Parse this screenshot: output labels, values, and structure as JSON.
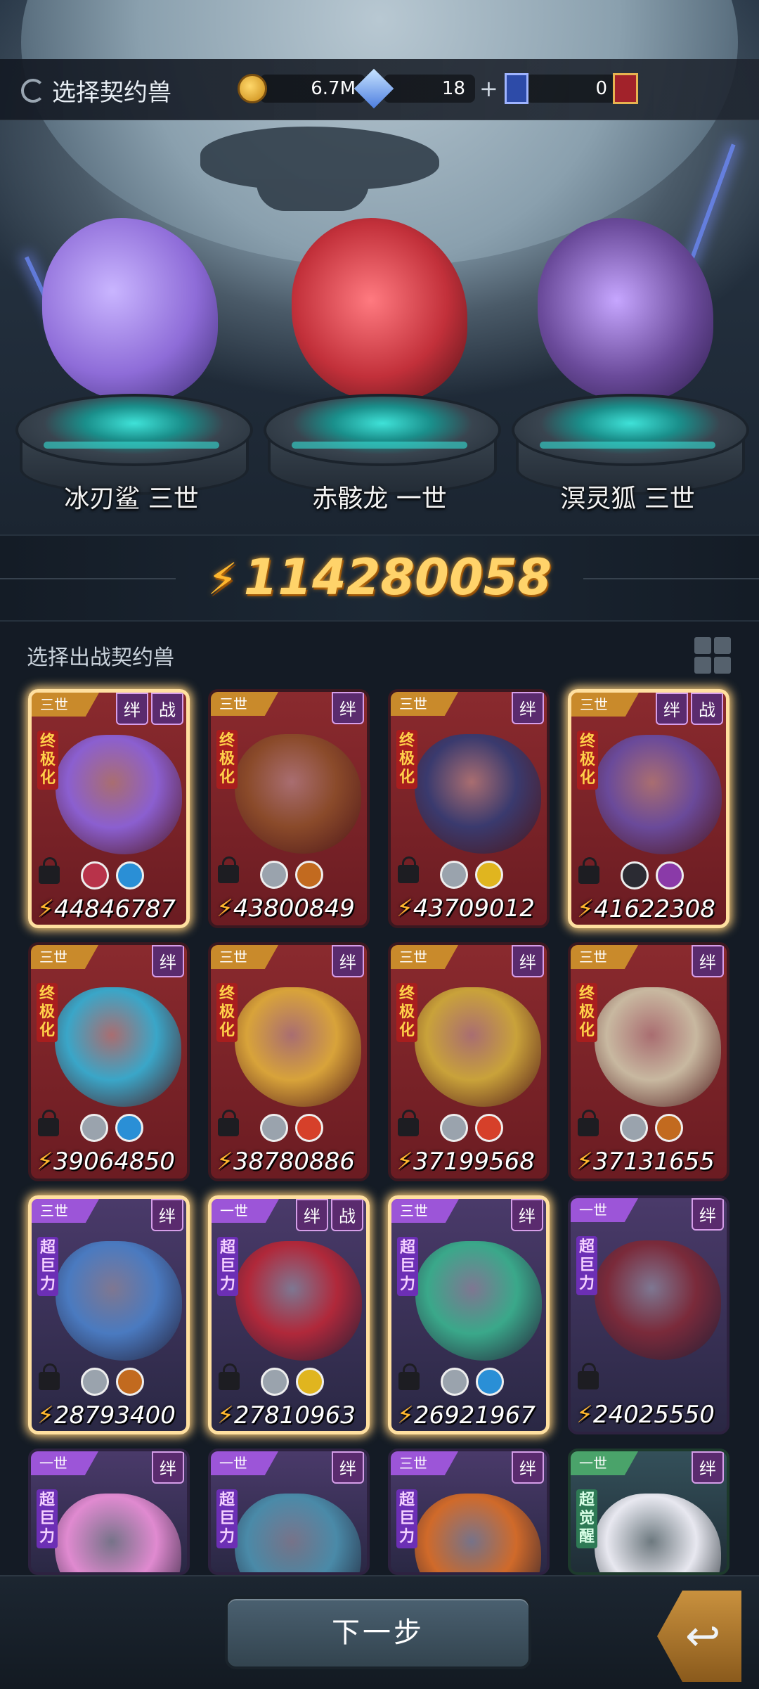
{
  "header": {
    "title": "选择契约兽",
    "resources": [
      {
        "icon": "coin-icon",
        "value": "6.7M"
      },
      {
        "icon": "gem-icon",
        "value": "18"
      },
      {
        "icon": "ticket-icon",
        "value": "0"
      },
      {
        "icon": "gold-ticket-icon",
        "value": ""
      }
    ]
  },
  "team": [
    {
      "name": "冰刃鲨 三世",
      "color": "#8e6cd8"
    },
    {
      "name": "赤骸龙 一世",
      "color": "#c2303a"
    },
    {
      "name": "溟灵狐 三世",
      "color": "#6a4a9a"
    }
  ],
  "total_power": "114280058",
  "section_label": "选择出战契约兽",
  "cards": [
    {
      "tier": "三世",
      "tags": [
        "绊",
        "战"
      ],
      "badge": "终极化",
      "power": "44846787",
      "style": "red",
      "selected": true,
      "art": "#8b5fd0",
      "elements": [
        "#b8334a",
        "#2a8fd6"
      ]
    },
    {
      "tier": "三世",
      "tags": [
        "绊"
      ],
      "badge": "终极化",
      "power": "43800849",
      "style": "red",
      "selected": false,
      "art": "#8a4a2a",
      "elements": [
        "#9aa3ad",
        "#c26a1f"
      ]
    },
    {
      "tier": "三世",
      "tags": [
        "绊"
      ],
      "badge": "终极化",
      "power": "43709012",
      "style": "red",
      "selected": false,
      "art": "#3a3a6e",
      "elements": [
        "#9aa3ad",
        "#e0b51f"
      ]
    },
    {
      "tier": "三世",
      "tags": [
        "绊",
        "战"
      ],
      "badge": "终极化",
      "power": "41622308",
      "style": "red",
      "selected": true,
      "art": "#6a4a9a",
      "elements": [
        "#2b2b33",
        "#8a3aa8"
      ]
    },
    {
      "tier": "三世",
      "tags": [
        "绊"
      ],
      "badge": "终极化",
      "power": "39064850",
      "style": "red",
      "selected": false,
      "art": "#3aa6c8",
      "elements": [
        "#9aa3ad",
        "#2a8fd6"
      ]
    },
    {
      "tier": "三世",
      "tags": [
        "绊"
      ],
      "badge": "终极化",
      "power": "38780886",
      "style": "red",
      "selected": false,
      "art": "#d8a33a",
      "elements": [
        "#9aa3ad",
        "#d6402a"
      ]
    },
    {
      "tier": "三世",
      "tags": [
        "绊"
      ],
      "badge": "终极化",
      "power": "37199568",
      "style": "red",
      "selected": false,
      "art": "#c9a23a",
      "elements": [
        "#9aa3ad",
        "#d6402a"
      ]
    },
    {
      "tier": "三世",
      "tags": [
        "绊"
      ],
      "badge": "终极化",
      "power": "37131655",
      "style": "red",
      "selected": false,
      "art": "#c8b8a0",
      "elements": [
        "#9aa3ad",
        "#c26a1f"
      ]
    },
    {
      "tier": "三世",
      "tags": [
        "绊"
      ],
      "badge": "超巨力",
      "power": "28793400",
      "style": "purple",
      "selected": true,
      "art": "#4a7ac0",
      "elements": [
        "#9aa3ad",
        "#c26a1f"
      ]
    },
    {
      "tier": "一世",
      "tags": [
        "绊",
        "战"
      ],
      "badge": "超巨力",
      "power": "27810963",
      "style": "purple",
      "selected": true,
      "art": "#b0283a",
      "elements": [
        "#9aa3ad",
        "#e0b51f"
      ]
    },
    {
      "tier": "三世",
      "tags": [
        "绊"
      ],
      "badge": "超巨力",
      "power": "26921967",
      "style": "purple",
      "selected": true,
      "art": "#3aa88a",
      "elements": [
        "#9aa3ad",
        "#2a8fd6"
      ]
    },
    {
      "tier": "一世",
      "tags": [
        "绊"
      ],
      "badge": "超巨力",
      "power": "24025550",
      "style": "purple",
      "selected": false,
      "art": "#7a2a3a",
      "elements": []
    },
    {
      "tier": "一世",
      "tags": [
        "绊"
      ],
      "badge": "超巨力",
      "power": "",
      "style": "purple",
      "selected": false,
      "art": "#e08ad0",
      "elements": []
    },
    {
      "tier": "一世",
      "tags": [
        "绊"
      ],
      "badge": "超巨力",
      "power": "",
      "style": "purple",
      "selected": false,
      "art": "#4a8aa8",
      "elements": []
    },
    {
      "tier": "三世",
      "tags": [
        "绊"
      ],
      "badge": "超巨力",
      "power": "",
      "style": "purple",
      "selected": false,
      "art": "#d06a2a",
      "elements": []
    },
    {
      "tier": "一世",
      "tags": [
        "绊"
      ],
      "badge": "超觉醒",
      "power": "",
      "style": "green",
      "selected": false,
      "art": "#e8e8f0",
      "elements": []
    }
  ],
  "footer": {
    "next_label": "下一步"
  }
}
